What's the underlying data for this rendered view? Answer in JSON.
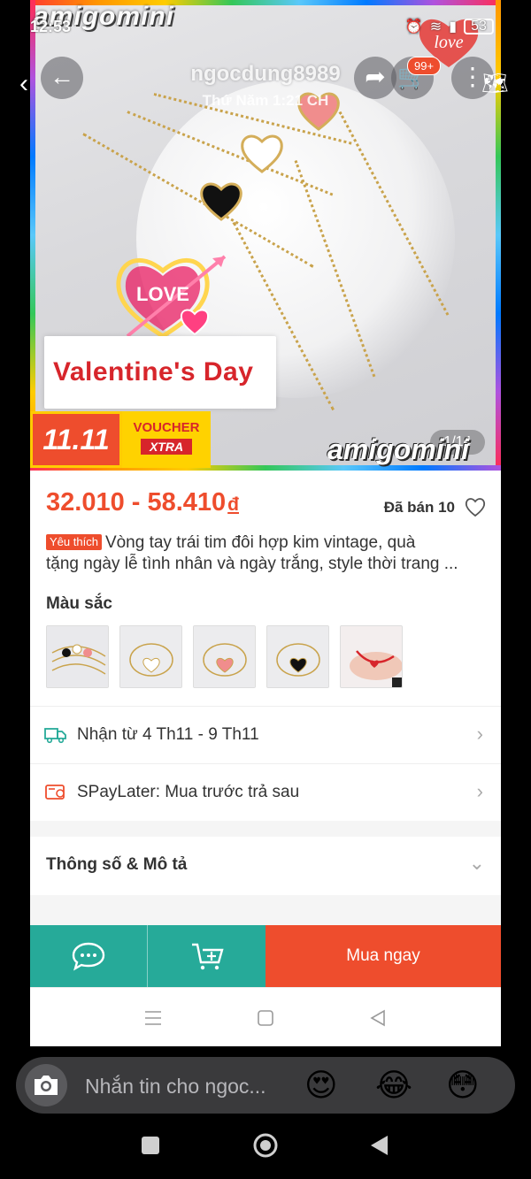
{
  "status": {
    "time": "12:53",
    "battery": "53"
  },
  "overlay": {
    "username": "ngocdung8989",
    "timestamp": "Thứ Năm 1:21 CH",
    "cart_count": "99+"
  },
  "hero": {
    "brand_top": "amigomini",
    "love_text": "LOVE",
    "valentine_text": "Valentine's Day",
    "sale_badge": "11.11",
    "voucher_label": "VOUCHER",
    "xtra_label": "XTRA",
    "page_counter": "1/14",
    "brand_bottom": "amigomini",
    "sticker_text": "love"
  },
  "product": {
    "price": "32.010 - 58.410",
    "currency": "đ",
    "sold": "Đã bán 10",
    "favorite_tag": "Yêu thích",
    "title": "Vòng tay trái tim đôi hợp kim vintage, quà tặng ngày lễ tình nhân và ngày trắng, style thời trang ...",
    "title_line1": "Vòng tay trái tim đôi hợp kim vintage, quà",
    "title_line2": "tặng ngày lễ tình nhân và ngày trắng, style thời trang ...",
    "color_label": "Màu sắc",
    "swatches": [
      "set-of-three",
      "white-heart",
      "pink-heart",
      "black-heart",
      "red-string"
    ]
  },
  "rows": {
    "delivery": "Nhận từ 4 Th11 - 9 Th11",
    "spaylater": "SPayLater: Mua trước trả sau",
    "specs": "Thông số & Mô tả"
  },
  "actions": {
    "buy_now": "Mua ngay"
  },
  "chat": {
    "placeholder": "Nhắn tin cho ngoc...",
    "emojis": [
      "😍",
      "😂",
      "😳"
    ]
  },
  "colors": {
    "shopee_orange": "#ee4d2d",
    "teal": "#26aa99"
  }
}
